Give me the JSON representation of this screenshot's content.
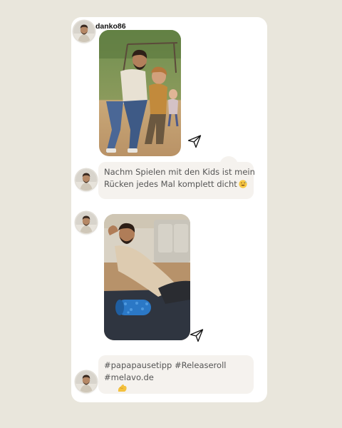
{
  "post": {
    "username": "danko86"
  },
  "messages": [
    {
      "type": "image",
      "image_description": "father playing with two kids on a playground",
      "send_icon": "send-icon"
    },
    {
      "type": "text",
      "lines": [
        "Nachm Spielen mit den Kids ist mein",
        "Rücken jedes Mal komplett dicht"
      ],
      "emoji": "grinning-sweat-emoji"
    },
    {
      "type": "image",
      "image_description": "man doing a back stretch on a blue foam roller on a yoga mat",
      "send_icon": "send-icon"
    },
    {
      "type": "text",
      "lines": [
        "#papapausetipp #Releaseroll",
        "#melavo.de"
      ],
      "emoji": "flexed-biceps-emoji"
    }
  ],
  "colors": {
    "background": "#e9e6dc",
    "card": "#ffffff",
    "bubble": "#f5f2ee",
    "bubble_text": "#555555"
  }
}
